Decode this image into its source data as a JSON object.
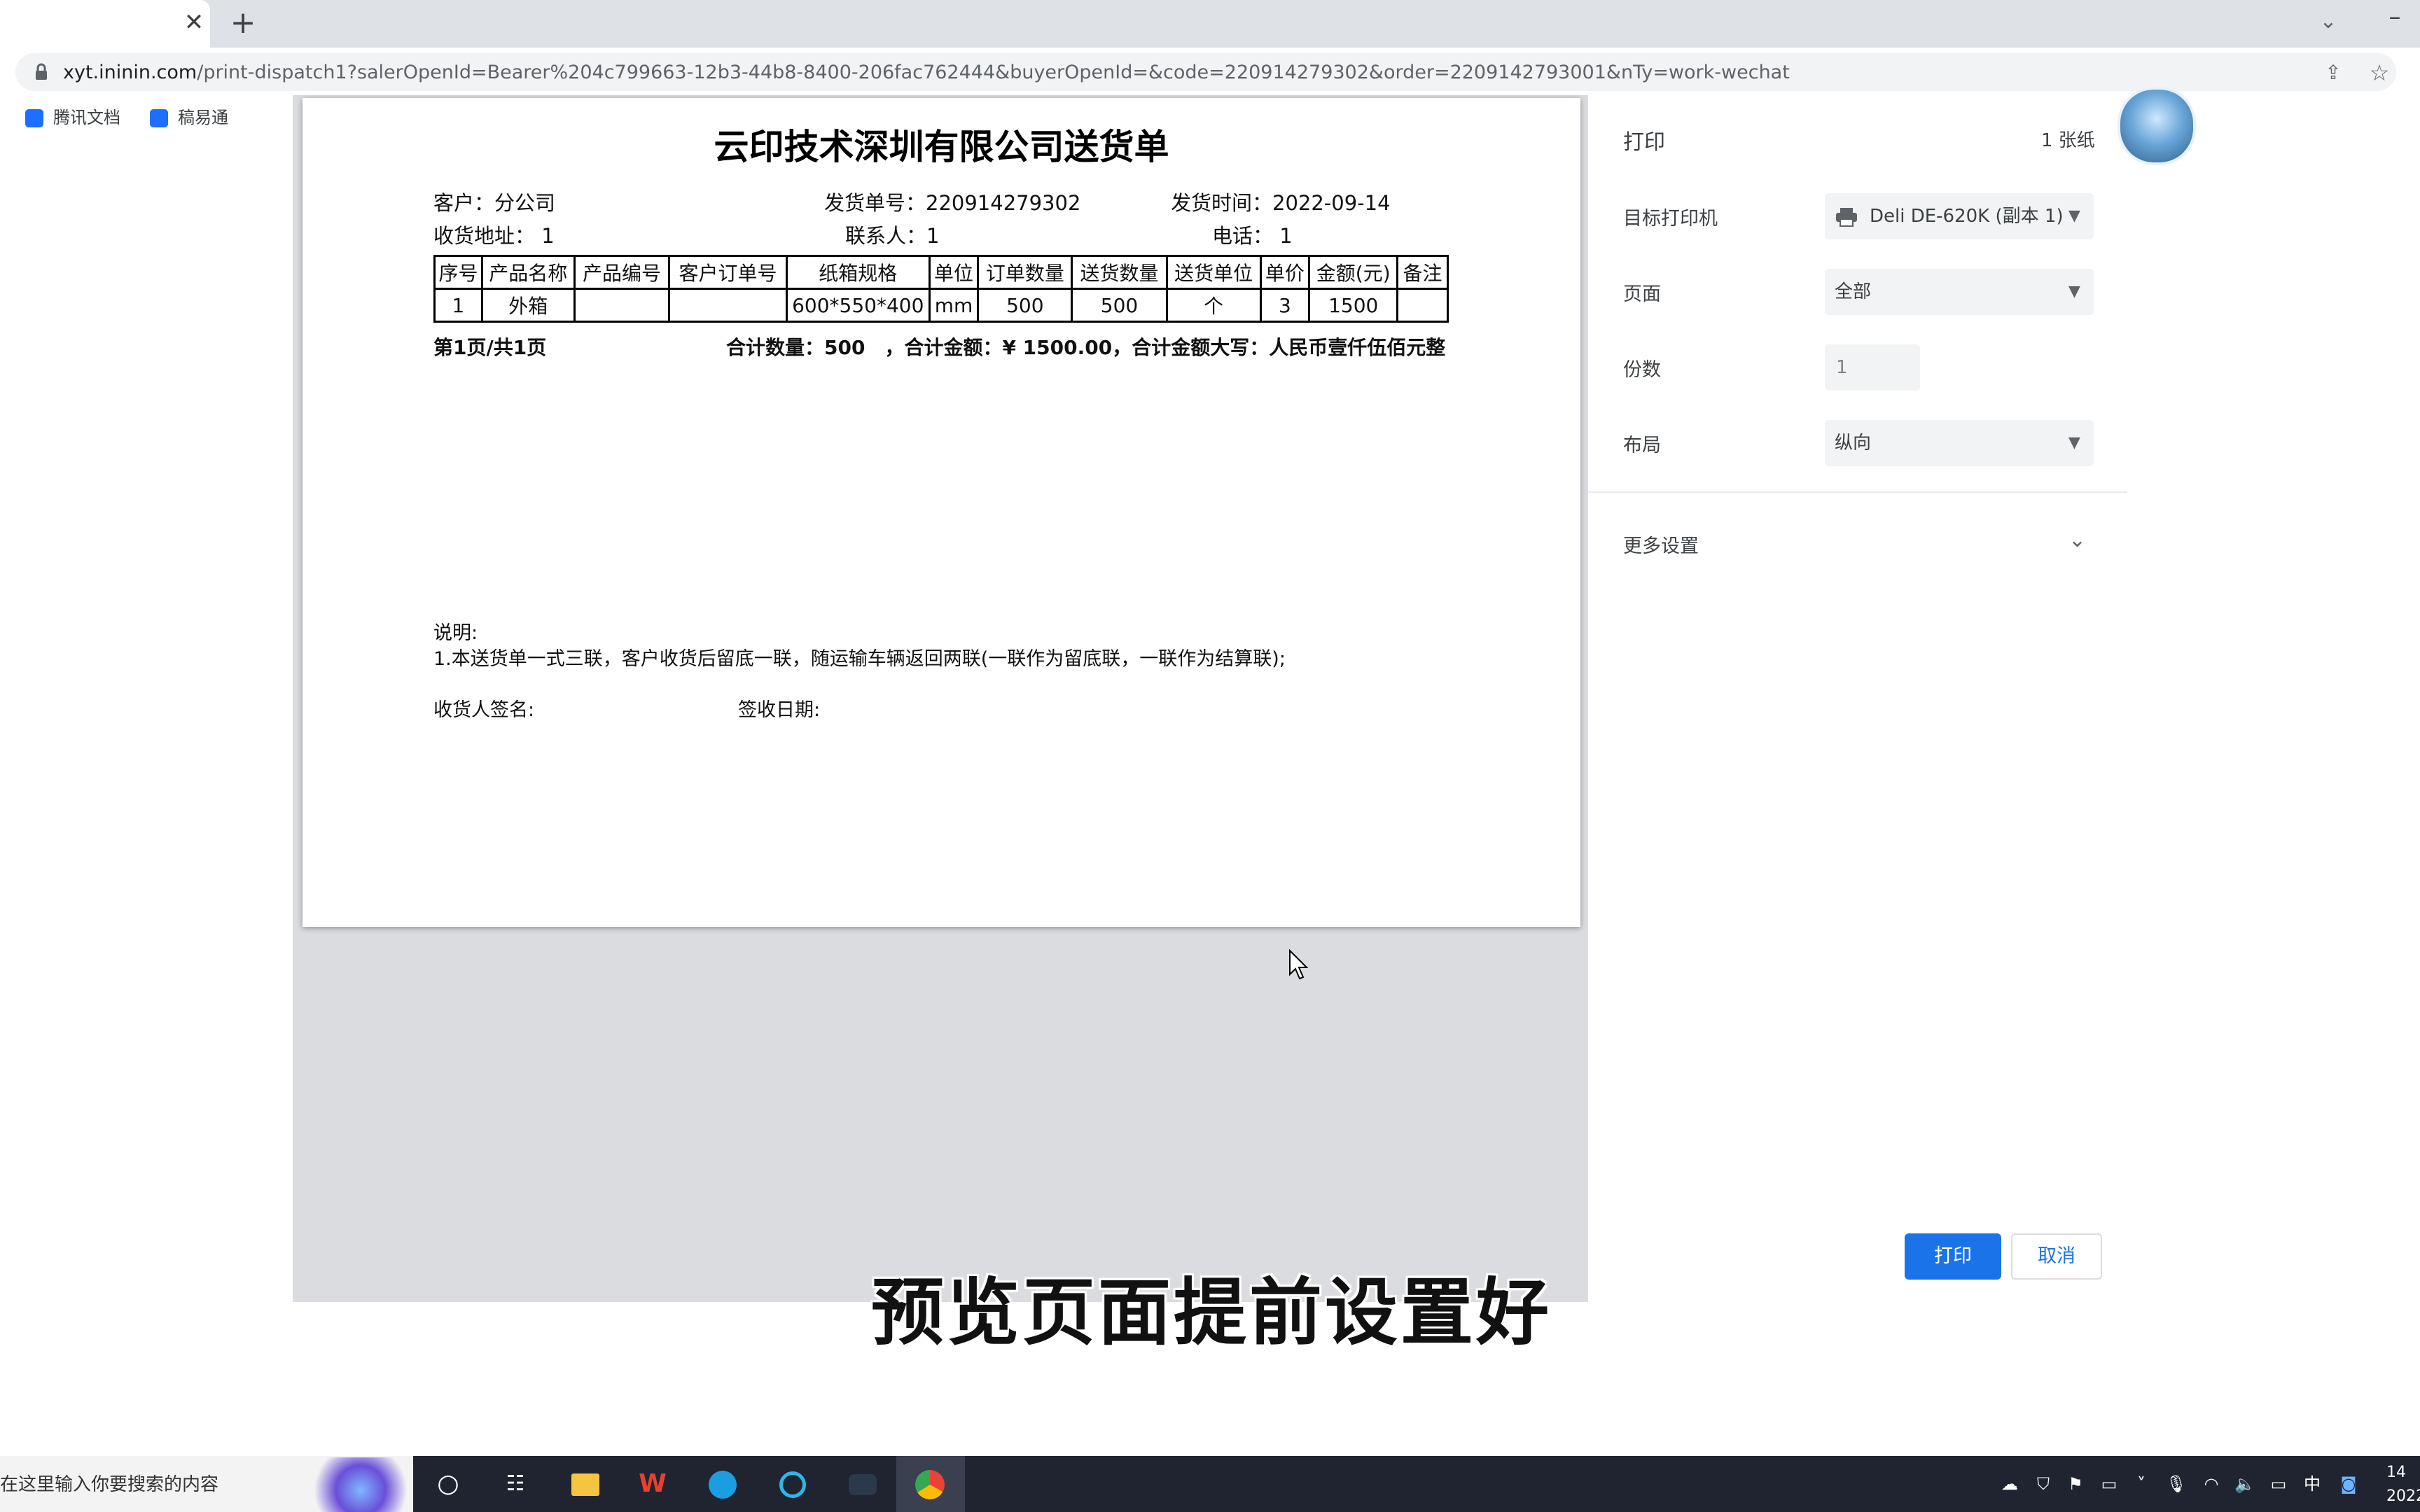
{
  "browser": {
    "url_host": "xyt.ininin.com",
    "url_path": "/print-dispatch1?salerOpenId=Bearer%204c799663-12b3-44b8-8400-206fac762444&buyerOpenId=&code=220914279302&order=2209142793001&nTy=work-wechat",
    "bookmarks": [
      {
        "label": "腾讯文档",
        "icon": "tencent-docs-icon",
        "color": "#1e6fff"
      },
      {
        "label": "稿易通",
        "icon": "gaoyitong-icon",
        "color": "#1e6fff"
      }
    ]
  },
  "document": {
    "title": "云印技术深圳有限公司送货单",
    "customer": "客户：分公司",
    "dispatch_no": "发货单号：220914279302",
    "dispatch_time": "发货时间：2022-09-14",
    "address": "收货地址：  1",
    "contact": "联系人：1",
    "phone": "电话：  1",
    "table": {
      "headers": [
        "序号",
        "产品名称",
        "产品编号",
        "客户订单号",
        "纸箱规格",
        "单位",
        "订单数量",
        "送货数量",
        "送货单位",
        "单价",
        "金额(元)",
        "备注"
      ],
      "rows": [
        [
          "1",
          "外箱",
          "",
          "",
          "600*550*400",
          "mm",
          "500",
          "500",
          "个",
          "3",
          "1500",
          ""
        ]
      ]
    },
    "page_info": "第1页/共1页",
    "totals": "合计数量：500　，合计金额：¥ 1500.00，合计金额大写：人民币壹仟伍佰元整",
    "notes_title": "说明:",
    "notes_line": "1.本送货单一式三联，客户收货后留底一联，随运输车辆返回两联(一联作为留底联，一联作为结算联);",
    "receiver_sign": "收货人签名:",
    "sign_date": "签收日期:"
  },
  "print_dialog": {
    "title": "打印",
    "sheet_count": "1 张纸",
    "printer_label": "目标打印机",
    "printer_value": "Deli DE-620K (副本 1)",
    "pages_label": "页面",
    "pages_value": "全部",
    "copies_label": "份数",
    "copies_value": "1",
    "layout_label": "布局",
    "layout_value": "纵向",
    "more_settings": "更多设置",
    "print_button": "打印",
    "cancel_button": "取消"
  },
  "subtitle": "预览页面提前设置好",
  "taskbar": {
    "search_placeholder": "在这里输入你要搜索的内容",
    "ime": "中",
    "clock_partial": "14",
    "date_partial": "2022"
  },
  "colors": {
    "accent": "#1a73e8",
    "taskbar": "#1f2430",
    "preview_bg": "#dadce0"
  }
}
